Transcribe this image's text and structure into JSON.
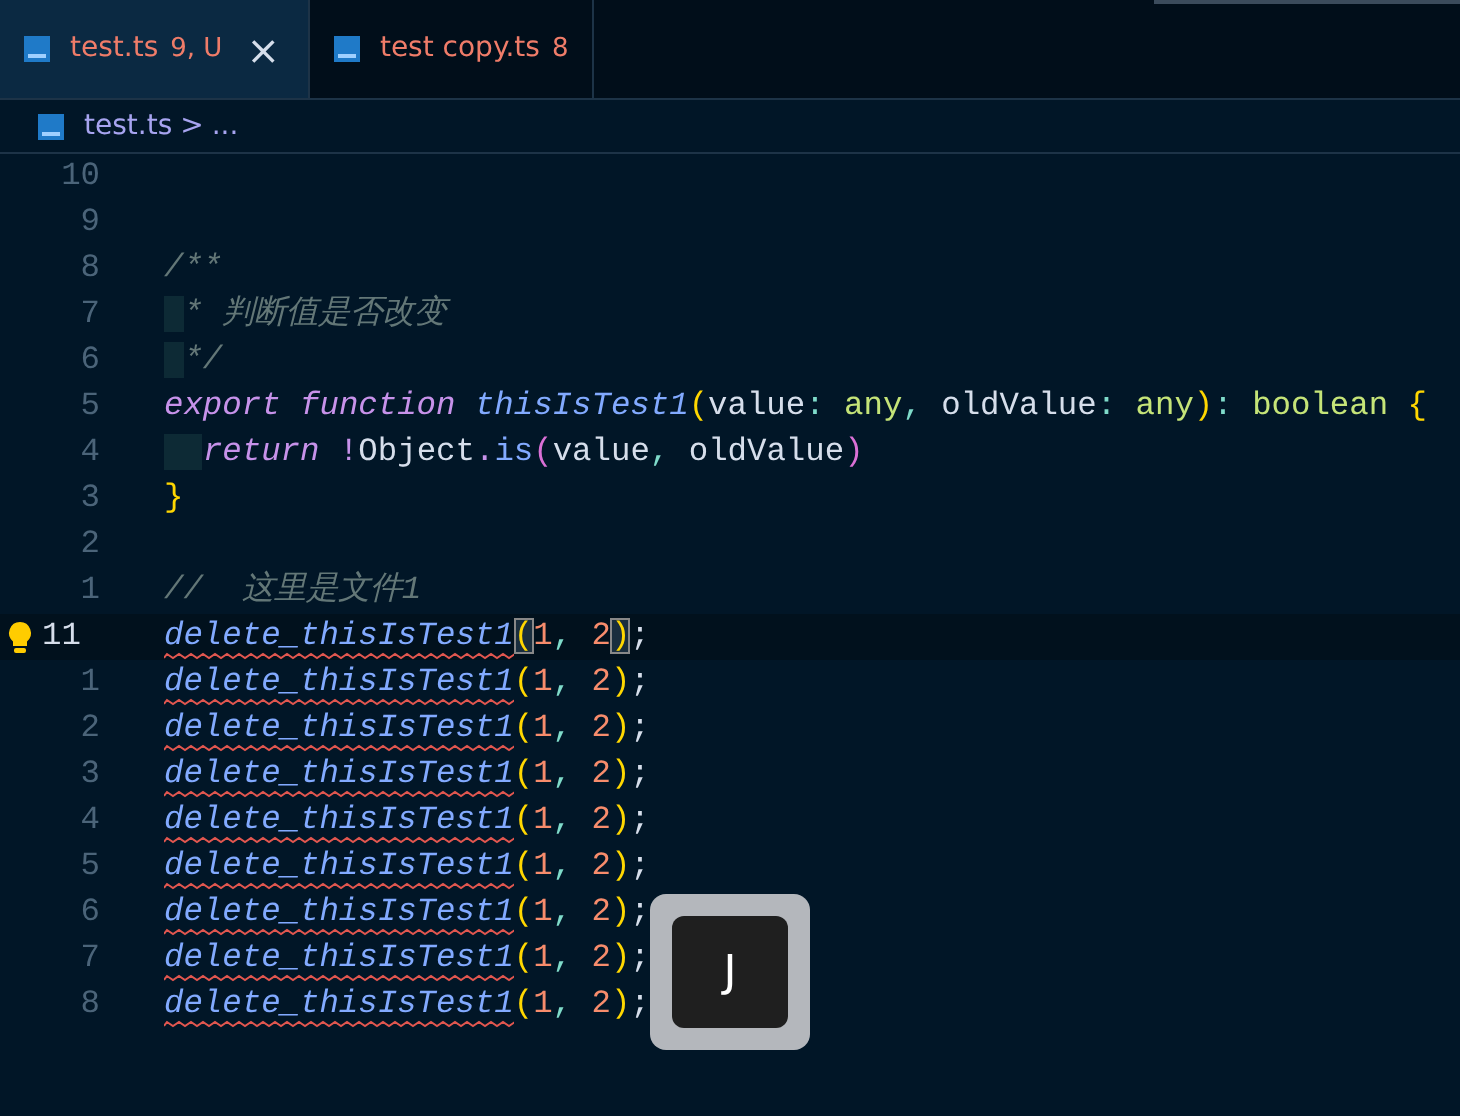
{
  "tabs": [
    {
      "label": "test.ts",
      "badge": "9, U",
      "close": "×",
      "selected": true
    },
    {
      "label": "test copy.ts",
      "badge": "8",
      "selected": false
    }
  ],
  "breadcrumb": {
    "file": "test.ts",
    "separator": ">",
    "rest": "..."
  },
  "lines": [
    {
      "number": "10",
      "selected": false
    },
    {
      "number": "9",
      "selected": false
    },
    {
      "number": "8",
      "selected": false,
      "tokens": [
        {
          "text": "/**",
          "kind": "comment"
        }
      ]
    },
    {
      "number": "7",
      "selected": false,
      "tokens": [
        {
          "text": " * 判断值是否改变",
          "kind": "comment"
        }
      ]
    },
    {
      "number": "6",
      "selected": false,
      "tokens": [
        {
          "text": " */",
          "kind": "comment"
        }
      ]
    },
    {
      "number": "5",
      "selected": false,
      "tokens": [
        {
          "text": "export",
          "kind": "keyword"
        },
        {
          "text": " function",
          "kind": "keyword"
        },
        {
          "text": " thisIsTest1",
          "kind": "func"
        },
        {
          "text": "(",
          "kind": "brace"
        },
        {
          "text": "value",
          "kind": "plain"
        },
        {
          "text": ":",
          "kind": "punct"
        },
        {
          "text": " any",
          "kind": "type"
        },
        {
          "text": ",",
          "kind": "punct"
        },
        {
          "text": " oldValue",
          "kind": "plain"
        },
        {
          "text": ":",
          "kind": "punct"
        },
        {
          "text": " any",
          "kind": "type"
        },
        {
          "text": ")",
          "kind": "brace"
        },
        {
          "text": ":",
          "kind": "punct"
        },
        {
          "text": " boolean",
          "kind": "type"
        },
        {
          "text": " {",
          "kind": "brace"
        }
      ]
    },
    {
      "number": "4",
      "selected": false,
      "tokens": [
        {
          "text": "  return",
          "kind": "keyword"
        },
        {
          "text": " !",
          "kind": "operator"
        },
        {
          "text": "Object",
          "kind": "plain"
        },
        {
          "text": ".",
          "kind": "operator"
        },
        {
          "text": "is",
          "kind": "call"
        },
        {
          "text": "(",
          "kind": "paren"
        },
        {
          "text": "value",
          "kind": "plain"
        },
        {
          "text": ",",
          "kind": "punct"
        },
        {
          "text": " oldValue",
          "kind": "plain"
        },
        {
          "text": ")",
          "kind": "paren"
        }
      ]
    },
    {
      "number": "3",
      "selected": false,
      "tokens": [
        {
          "text": "}",
          "kind": "brace"
        }
      ]
    },
    {
      "number": "2",
      "selected": false
    },
    {
      "number": "1",
      "selected": false,
      "tokens": [
        {
          "text": "//  这里是文件1",
          "kind": "comment"
        }
      ]
    },
    {
      "number": "11",
      "selected": true,
      "error": true,
      "tokens": [
        {
          "text": "delete_thisIsTest1",
          "kind": "func"
        },
        {
          "text": "(",
          "kind": "brace"
        },
        {
          "text": "1",
          "kind": "number"
        },
        {
          "text": ",",
          "kind": "punct"
        },
        {
          "text": " 2",
          "kind": "number"
        },
        {
          "text": ")",
          "kind": "brace"
        },
        {
          "text": ";",
          "kind": "plain"
        }
      ]
    },
    {
      "number": "1",
      "selected": false,
      "error": true,
      "tokens": [
        {
          "text": "delete_thisIsTest1",
          "kind": "func"
        },
        {
          "text": "(",
          "kind": "brace"
        },
        {
          "text": "1",
          "kind": "number"
        },
        {
          "text": ",",
          "kind": "punct"
        },
        {
          "text": " 2",
          "kind": "number"
        },
        {
          "text": ")",
          "kind": "brace"
        },
        {
          "text": ";",
          "kind": "plain"
        }
      ]
    },
    {
      "number": "2",
      "selected": false,
      "error": true,
      "tokens": [
        {
          "text": "delete_thisIsTest1",
          "kind": "func"
        },
        {
          "text": "(",
          "kind": "brace"
        },
        {
          "text": "1",
          "kind": "number"
        },
        {
          "text": ",",
          "kind": "punct"
        },
        {
          "text": " 2",
          "kind": "number"
        },
        {
          "text": ")",
          "kind": "brace"
        },
        {
          "text": ";",
          "kind": "plain"
        }
      ]
    },
    {
      "number": "3",
      "selected": false,
      "error": true,
      "tokens": [
        {
          "text": "delete_thisIsTest1",
          "kind": "func"
        },
        {
          "text": "(",
          "kind": "brace"
        },
        {
          "text": "1",
          "kind": "number"
        },
        {
          "text": ",",
          "kind": "punct"
        },
        {
          "text": " 2",
          "kind": "number"
        },
        {
          "text": ")",
          "kind": "brace"
        },
        {
          "text": ";",
          "kind": "plain"
        }
      ]
    },
    {
      "number": "4",
      "selected": false,
      "error": true,
      "tokens": [
        {
          "text": "delete_thisIsTest1",
          "kind": "func"
        },
        {
          "text": "(",
          "kind": "brace"
        },
        {
          "text": "1",
          "kind": "number"
        },
        {
          "text": ",",
          "kind": "punct"
        },
        {
          "text": " 2",
          "kind": "number"
        },
        {
          "text": ")",
          "kind": "brace"
        },
        {
          "text": ";",
          "kind": "plain"
        }
      ]
    },
    {
      "number": "5",
      "selected": false,
      "error": true,
      "tokens": [
        {
          "text": "delete_thisIsTest1",
          "kind": "func"
        },
        {
          "text": "(",
          "kind": "brace"
        },
        {
          "text": "1",
          "kind": "number"
        },
        {
          "text": ",",
          "kind": "punct"
        },
        {
          "text": " 2",
          "kind": "number"
        },
        {
          "text": ")",
          "kind": "brace"
        },
        {
          "text": ";",
          "kind": "plain"
        }
      ]
    },
    {
      "number": "6",
      "selected": false,
      "error": true,
      "tokens": [
        {
          "text": "delete_thisIsTest1",
          "kind": "func"
        },
        {
          "text": "(",
          "kind": "brace"
        },
        {
          "text": "1",
          "kind": "number"
        },
        {
          "text": ",",
          "kind": "punct"
        },
        {
          "text": " 2",
          "kind": "number"
        },
        {
          "text": ")",
          "kind": "brace"
        },
        {
          "text": ";",
          "kind": "plain"
        }
      ]
    },
    {
      "number": "7",
      "selected": false,
      "error": true,
      "tokens": [
        {
          "text": "delete_thisIsTest1",
          "kind": "func"
        },
        {
          "text": "(",
          "kind": "brace"
        },
        {
          "text": "1",
          "kind": "number"
        },
        {
          "text": ",",
          "kind": "punct"
        },
        {
          "text": " 2",
          "kind": "number"
        },
        {
          "text": ")",
          "kind": "brace"
        },
        {
          "text": ";",
          "kind": "plain"
        }
      ]
    },
    {
      "number": "8",
      "selected": false,
      "error": true,
      "tokens": [
        {
          "text": "delete_thisIsTest1",
          "kind": "func"
        },
        {
          "text": "(",
          "kind": "brace"
        },
        {
          "text": "1",
          "kind": "number"
        },
        {
          "text": ",",
          "kind": "punct"
        },
        {
          "text": " 2",
          "kind": "number"
        },
        {
          "text": ")",
          "kind": "brace"
        },
        {
          "text": ";",
          "kind": "plain"
        }
      ]
    }
  ],
  "keystroke": {
    "key": "J"
  }
}
